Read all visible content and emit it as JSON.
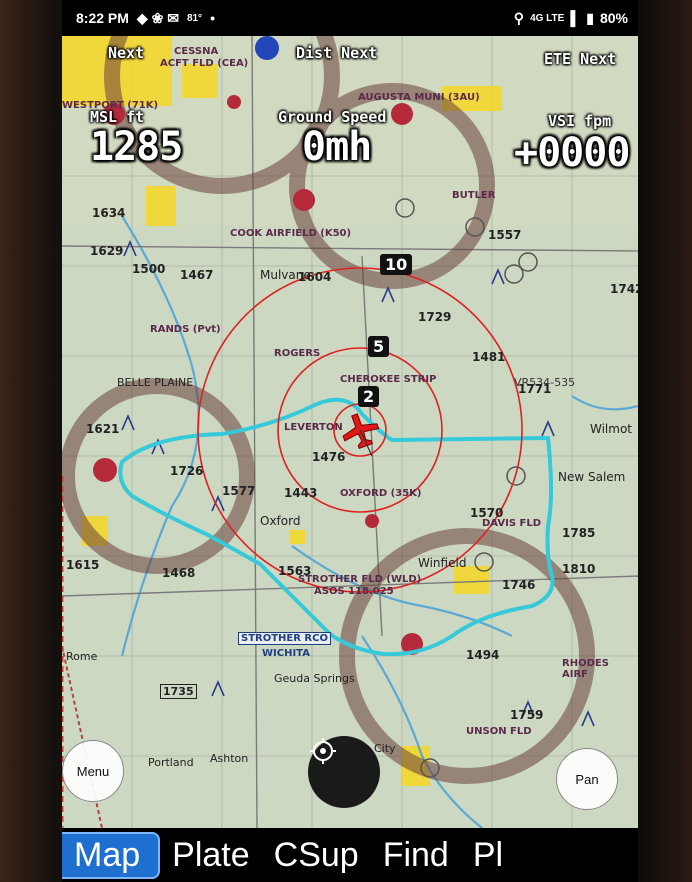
{
  "status_bar": {
    "time": "8:22 PM",
    "temp": "81°",
    "network": "4G LTE",
    "battery": "80%"
  },
  "hud": {
    "top_left_label": "Next",
    "top_mid_label": "Dist Next",
    "top_right_label": "ETE Next",
    "altitude_label": "MSL ft",
    "altitude_value": "1285",
    "ground_speed_label": "Ground Speed",
    "ground_speed_value": "0mh",
    "vsi_label": "VSI fpm",
    "vsi_value": "+0000"
  },
  "range_rings": {
    "inner": "2",
    "middle": "5",
    "outer": "10"
  },
  "chart_labels": {
    "cessna": "CESSNA",
    "acft_fld": "ACFT FLD (CEA)",
    "westport": "WESTPORT (71K)",
    "augusta": "AUGUSTA MUNI (3AU)",
    "butler": "BUTLER",
    "cook_airfield": "COOK AIRFIELD (K50)",
    "mulvane": "Mulvane",
    "rands": "RANDS (Pvt)",
    "rogers": "ROGERS",
    "cherokee_strip": "CHEROKEE STRIP",
    "belle_plaine": "BELLE PLAINE",
    "leverton": "LEVERTON",
    "oxford_airport": "OXFORD (35K)",
    "oxford_town": "Oxford",
    "wilmot": "Wilmot",
    "new_salem": "New Salem",
    "winfield": "Winfield",
    "davis_fld": "DAVIS FLD",
    "strother_fld": "STROTHER FLD (WLD)",
    "asos": "ASOS 118.025",
    "strother_rco": "STROTHER RCO",
    "wichita": "WICHITA",
    "geuda_springs": "Geuda Springs",
    "portland": "Portland",
    "ashton": "Ashton",
    "rhodes_airfield": "RHODES AIRF",
    "unsonfld": "UNSON FLD",
    "rome": "Rome",
    "city": "City",
    "elev_1634": "1634",
    "elev_1629": "1629",
    "elev_1500": "1500",
    "elev_1467": "1467",
    "elev_1604": "1604",
    "elev_1729": "1729",
    "elev_1557": "1557",
    "elev_1481": "1481",
    "elev_1771": "1771",
    "elev_1621": "1621",
    "elev_1726": "1726",
    "elev_1577": "1577",
    "elev_1443": "1443",
    "elev_1476": "1476",
    "elev_1570": "1570",
    "elev_1785": "1785",
    "elev_1810": "1810",
    "elev_1746": "1746",
    "elev_1563": "1563",
    "elev_1468": "1468",
    "elev_1494": "1494",
    "elev_1615": "1615",
    "elev_1759": "1759",
    "vr_route": "VR534-535",
    "elev_1742": "1742",
    "elev_1735": "1735"
  },
  "buttons": {
    "menu": "Menu",
    "pan": "Pan"
  },
  "tabs": [
    "Map",
    "Plate",
    "CSup",
    "Find",
    "Pl"
  ],
  "colors": {
    "route": "#35c9d9",
    "rings": "#e02020",
    "aircraft": "#e01818",
    "active_tab": "#1f6fd1"
  }
}
